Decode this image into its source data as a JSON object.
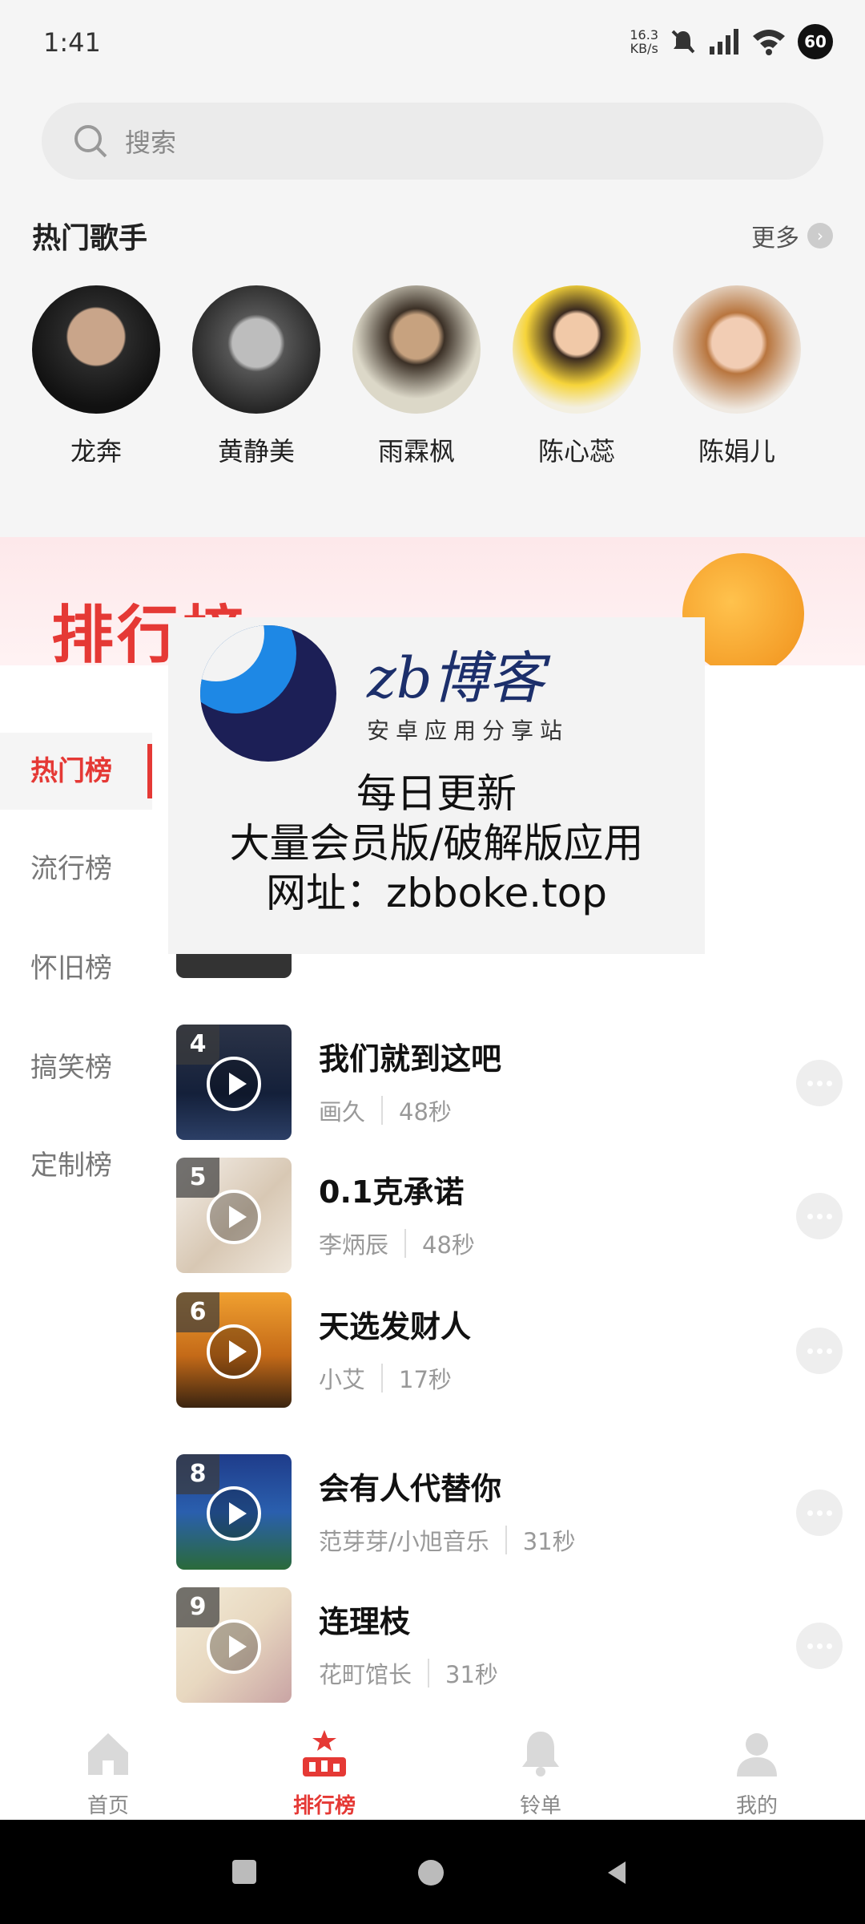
{
  "status_bar": {
    "time": "1:41",
    "net_speed_value": "16.3",
    "net_speed_unit": "KB/s",
    "battery": "60"
  },
  "search": {
    "placeholder": "搜索"
  },
  "hot_singers": {
    "title": "热门歌手",
    "more_label": "更多",
    "items": [
      {
        "name": "龙奔"
      },
      {
        "name": "黄静美"
      },
      {
        "name": "雨霖枫"
      },
      {
        "name": "陈心蕊"
      },
      {
        "name": "陈娟儿"
      }
    ]
  },
  "ranking": {
    "title": "排行榜",
    "categories": [
      {
        "label": "热门榜",
        "active": true
      },
      {
        "label": "流行榜",
        "active": false
      },
      {
        "label": "怀旧榜",
        "active": false
      },
      {
        "label": "搞笑榜",
        "active": false
      },
      {
        "label": "定制榜",
        "active": false
      }
    ],
    "songs": [
      {
        "rank": "4",
        "title": "我们就到这吧",
        "artist": "画久",
        "duration": "48秒"
      },
      {
        "rank": "5",
        "title": "0.1克承诺",
        "artist": "李炳辰",
        "duration": "48秒"
      },
      {
        "rank": "6",
        "title": "天选发财人",
        "artist": "小艾",
        "duration": "17秒"
      },
      {
        "rank": "8",
        "title": "会有人代替你",
        "artist": "范芽芽/小旭音乐",
        "duration": "31秒"
      },
      {
        "rank": "9",
        "title": "连理枝",
        "artist": "花町馆长",
        "duration": "31秒"
      }
    ]
  },
  "promo_overlay": {
    "brand": "zb博客",
    "subtitle": "安卓应用分享站",
    "line1": "每日更新",
    "line2": "大量会员版/破解版应用",
    "line3": "网址：zbboke.top"
  },
  "bottom_nav": {
    "items": [
      {
        "label": "首页",
        "icon": "home-icon"
      },
      {
        "label": "排行榜",
        "icon": "ranking-icon"
      },
      {
        "label": "铃单",
        "icon": "bell-icon"
      },
      {
        "label": "我的",
        "icon": "user-icon"
      }
    ]
  },
  "colors": {
    "accent": "#e53935",
    "background": "#f5f5f5"
  }
}
